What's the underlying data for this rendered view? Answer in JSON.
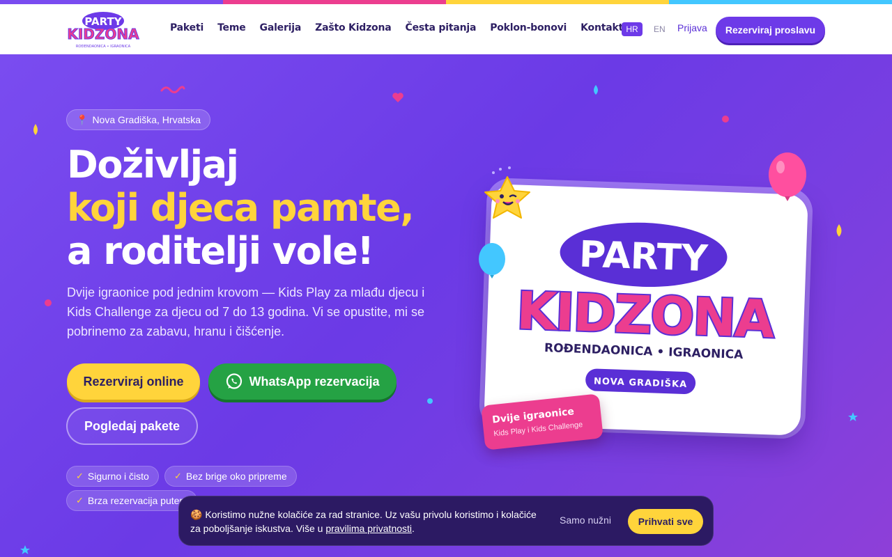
{
  "brand": {
    "logo_top": "PARTY",
    "logo_main": "KIDZONA",
    "logo_sub": "ROĐENDAONICA • IGRAONICA",
    "stripe_colors": [
      "#7a4cf0",
      "#ec3d8f",
      "#ffd43b",
      "#43c7ff"
    ]
  },
  "nav": {
    "items": [
      "Paketi",
      "Teme",
      "Galerija",
      "Zašto Kidzona",
      "Česta pitanja",
      "Poklon-bonovi",
      "Kontakt"
    ],
    "lang_active": "HR",
    "lang_other": "EN",
    "login": "Prijava",
    "cta": "Rezerviraj proslavu"
  },
  "hero": {
    "location": "Nova Gradiška, Hrvatska",
    "title_line1": "Doživljaj",
    "title_line2": "koji djeca pamte,",
    "title_line3": "a roditelji vole!",
    "subtitle": "Dvije igraonice pod jednim krovom — Kids Play za mlađu djecu i Kids Challenge za djecu od 7 do 13 godina. Vi se opustite, mi se pobrinemo za zabavu, hranu i čišćenje.",
    "btn_book": "Rezerviraj online",
    "btn_whatsapp": "WhatsApp rezervacija",
    "btn_packages": "Pogledaj pakete",
    "chips": [
      "Sigurno i čisto",
      "Bez brige oko pripreme",
      "Brza rezervacija putem"
    ]
  },
  "card": {
    "logo_top": "PARTY",
    "logo_main": "KIDZONA",
    "logo_sub": "ROĐENDAONICA • IGRAONICA",
    "city_badge": "NOVA GRADIŠKA",
    "tag_title": "Dvije igraonice",
    "tag_sub": "Kids Play i Kids Challenge"
  },
  "cookie": {
    "text": "🍪 Koristimo nužne kolačiće za rad stranice. Uz vašu privolu koristimo i kolačiće za poboljšanje iskustva. Više u ",
    "link": "pravilima privatnosti",
    "tail": ".",
    "necessary": "Samo nužni",
    "accept": "Prihvati sve"
  },
  "colors": {
    "primary": "#6d3ae8",
    "accent_yellow": "#ffd43b",
    "whatsapp_green": "#25a244",
    "pink": "#ec3d8f",
    "navy": "#2d1f63"
  }
}
